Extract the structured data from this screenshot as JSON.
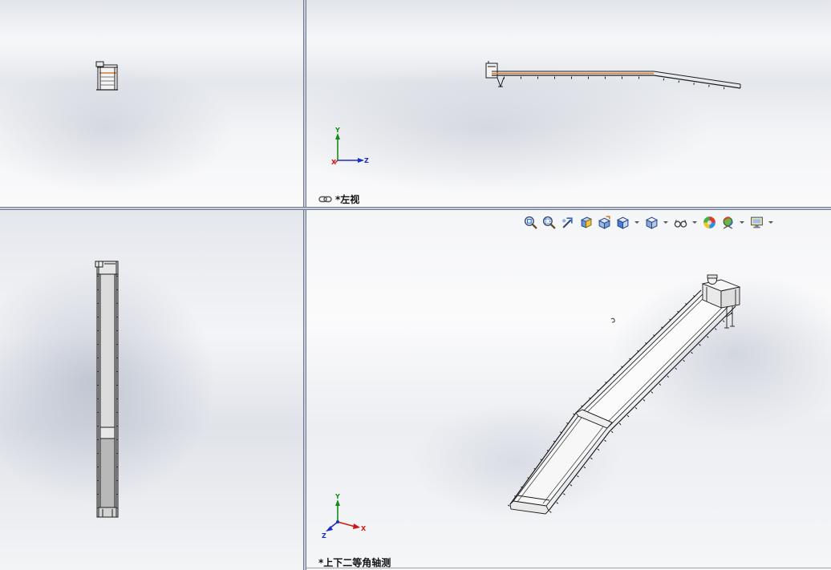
{
  "colors": {
    "divider": "#6d7894",
    "triad_x": "#d01818",
    "triad_y": "#178a17",
    "triad_z": "#1c2fc4",
    "highlighted_edge": "#d9782f"
  },
  "toolbar": {
    "items": [
      {
        "icon": "zoom-to-fit-icon"
      },
      {
        "icon": "zoom-to-area-icon"
      },
      {
        "icon": "previous-view-icon"
      },
      {
        "icon": "section-view-icon"
      },
      {
        "icon": "dynamic-annotation-views-icon"
      },
      {
        "icon": "view-orientation-icon",
        "dropdown": true
      },
      {
        "icon": "display-style-icon",
        "dropdown": true
      },
      {
        "icon": "hide-show-items-icon",
        "dropdown": true
      },
      {
        "icon": "edit-appearance-icon"
      },
      {
        "icon": "apply-scene-icon",
        "dropdown": true
      },
      {
        "icon": "view-settings-icon",
        "dropdown": true
      }
    ]
  },
  "viewports": {
    "top_right": {
      "label": "*左视",
      "label_icon": "link-views-icon",
      "triad": {
        "x": "X",
        "y": "Y",
        "z": "Z"
      }
    },
    "bottom_right": {
      "label": "*上下二等角轴测",
      "triad": {
        "x": "X",
        "y": "Y",
        "z": "Z"
      }
    }
  }
}
